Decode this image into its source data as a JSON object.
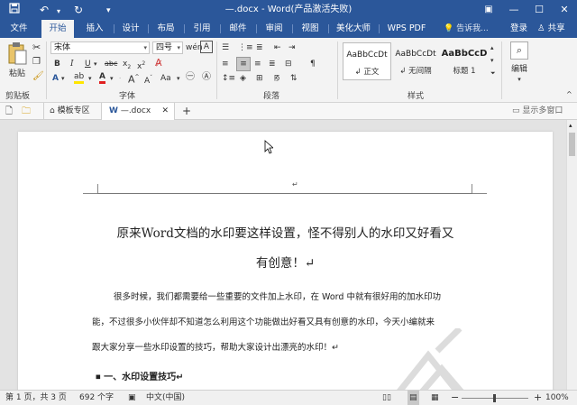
{
  "titlebar": {
    "title": "—.docx - Word(产品激活失败)",
    "icons": [
      "save-icon",
      "undo-icon",
      "redo-icon",
      "customize-icon"
    ]
  },
  "tabs": [
    {
      "label": "文件",
      "active": false
    },
    {
      "label": "开始",
      "active": true
    },
    {
      "label": "插入",
      "active": false
    },
    {
      "label": "设计",
      "active": false
    },
    {
      "label": "布局",
      "active": false
    },
    {
      "label": "引用",
      "active": false
    },
    {
      "label": "邮件",
      "active": false
    },
    {
      "label": "审阅",
      "active": false
    },
    {
      "label": "视图",
      "active": false
    },
    {
      "label": "美化大师",
      "active": false
    },
    {
      "label": "WPS PDF",
      "active": false
    }
  ],
  "tell_me": "告诉我...",
  "login": "登录",
  "share": "共享",
  "ribbon": {
    "clipboard": {
      "paste": "粘贴",
      "group": "剪贴板"
    },
    "font": {
      "name": "宋体",
      "size": "四号",
      "group": "字体"
    },
    "paragraph": {
      "group": "段落"
    },
    "styles": {
      "group": "样式",
      "items": [
        {
          "sample": "AaBbCcDt",
          "name": "↲ 正文"
        },
        {
          "sample": "AaBbCcDt",
          "name": "↲ 无间隔"
        },
        {
          "sample": "AaBbCcD",
          "name": "标题 1"
        }
      ]
    },
    "editing": {
      "label": "编辑"
    }
  },
  "doctabs": {
    "template": "模板专区",
    "doc": "—.docx",
    "show_multi": "显示多窗口"
  },
  "document": {
    "header_mark": "↵",
    "title_line1": "原来Word文档的水印要这样设置，怪不得别人的水印又好看又",
    "title_line2": "有创意！↵",
    "para_line1": "很多时候，我们都需要给一些重要的文件加上水印，在 Word 中就有很好用的加水印功",
    "para_line2": "能，不过很多小伙伴却不知道怎么利用这个功能做出好看又具有创意的水印，今天小编就来",
    "para_line3": "跟大家分享一些水印设置的技巧，帮助大家设计出漂亮的水印！↵",
    "heading": "一、水印设置技巧↵"
  },
  "statusbar": {
    "page": "第 1 页，共 3 页",
    "words": "692 个字",
    "lang": "中文(中国)",
    "zoom": "100%"
  }
}
